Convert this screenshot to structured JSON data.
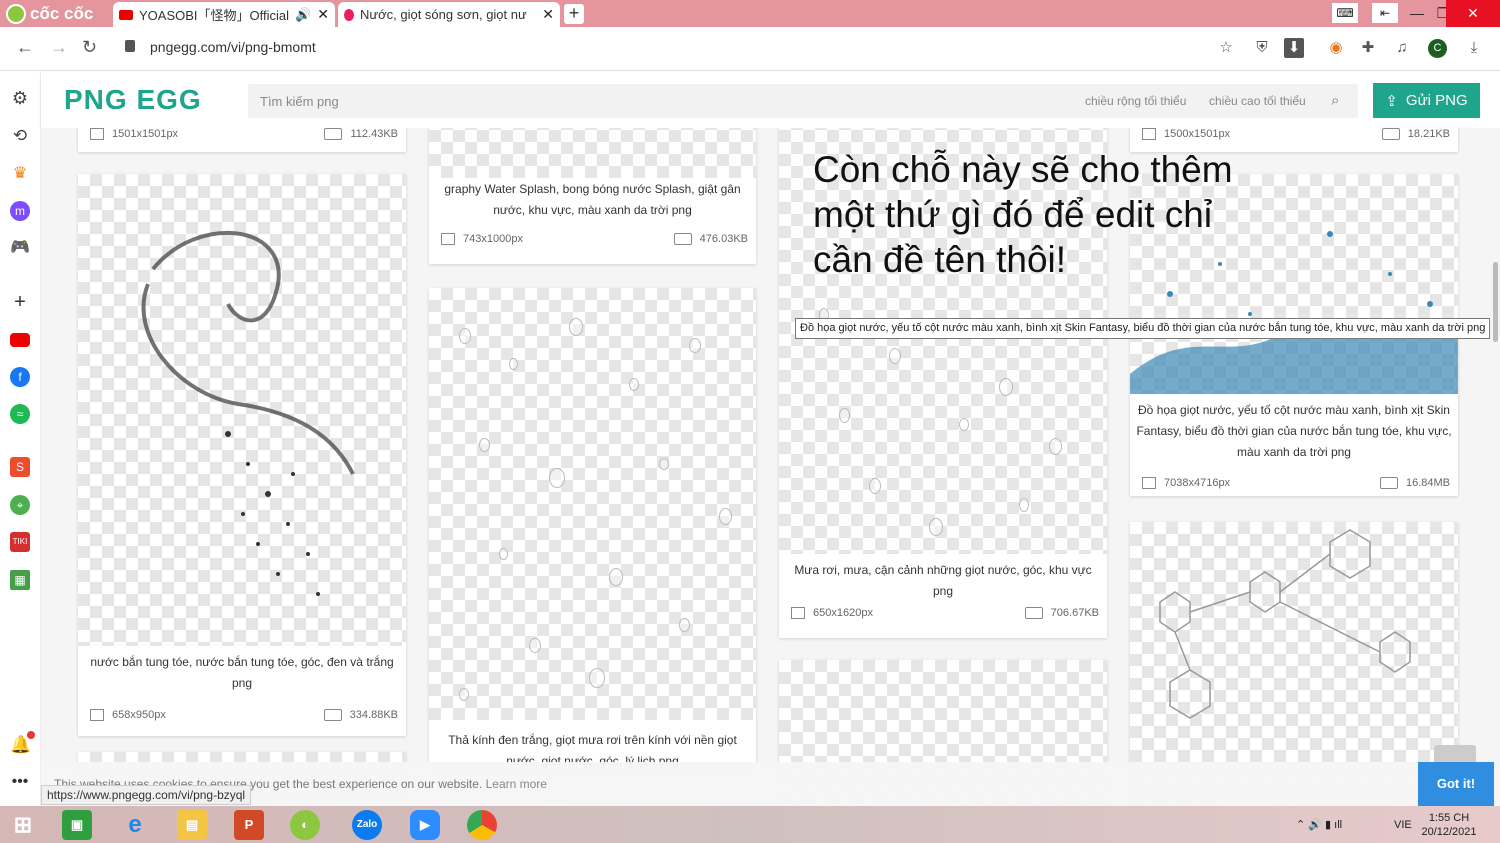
{
  "browser": {
    "brand": "cốc cốc",
    "tabs": [
      {
        "label": "YOASOBI「怪物」Official M"
      },
      {
        "label": "Nước, giọt sóng sơn, giọt nư"
      }
    ],
    "new_tab": "+",
    "url": "pngegg.com/vi/png-bmomt",
    "avatar": "C"
  },
  "site": {
    "logo": "PNG EGG",
    "search_placeholder": "Tìm kiếm png",
    "filter_width": "chiều rộng tối thiểu",
    "filter_height": "chiều cao tối thiểu",
    "submit": "Gửi PNG"
  },
  "cards": [
    {
      "dims": "1501x1501px",
      "size": "112.43KB"
    },
    {
      "caption": "graphy Water Splash, bong bóng nước Splash, giật gân nước, khu vực, màu xanh da trời png",
      "dims": "743x1000px",
      "size": "476.03KB"
    },
    {
      "dims": "1500x1501px",
      "size": "18.21KB"
    },
    {
      "caption": "nước bắn tung tóe, nước bắn tung tóe, góc, đen và trắng png",
      "dims": "658x950px",
      "size": "334.88KB"
    },
    {
      "caption": "Thả kính đen trắng, giọt mưa rơi trên kính với nền giọt nước, giọt nước, góc, lý lịch png"
    },
    {
      "caption": "Mưa rơi, mưa, cận cảnh những giọt nước, góc, khu vực png",
      "dims": "650x1620px",
      "size": "706.67KB"
    },
    {
      "caption": "Đồ họa giọt nước, yếu tố cột nước màu xanh, bình xịt Skin Fantasy, biểu đồ thời gian của nước bắn tung tóe, khu vực, màu xanh da trời png",
      "dims": "7038x4716px",
      "size": "16.84MB"
    }
  ],
  "overlay_note": "Còn chỗ này sẽ cho thêm một thứ gì đó để edit chỉ cần đề tên thôi!",
  "tooltip": "Đồ họa giọt nước, yếu tố cột nước màu xanh, bình xịt Skin Fantasy, biểu đồ thời gian của nước bắn tung tóe, khu vực, màu xanh da trời png",
  "cookie": {
    "text": "This website uses cookies to ensure you get the best experience on our website.",
    "learn": "Learn more",
    "button": "Got it!"
  },
  "status_url": "https://www.pngegg.com/vi/png-bzyql",
  "taskbar": {
    "lang": "VIE",
    "time": "1:55 CH",
    "date": "20/12/2021"
  }
}
